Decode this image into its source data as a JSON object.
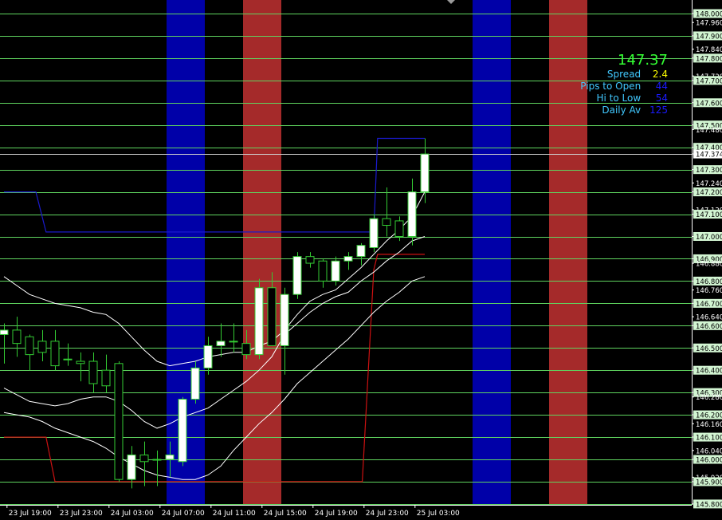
{
  "colors": {
    "background": "#000000",
    "grid": "#5fd45f",
    "bull_body": "#ffffff",
    "bear_body": "#000000",
    "candle_line": "#33cc33",
    "blue_band": "#0000a8",
    "red_band": "#a52a2a",
    "upper_channel": "#1a1acc",
    "lower_channel": "#cc1111",
    "ma_line": "#ffffff",
    "price_label_bg": "#d2f5d2",
    "axis_text": "#ffffff"
  },
  "info": {
    "price": "147.37",
    "price_color": "#33ff33",
    "label_color": "#41c8ff",
    "rows": [
      {
        "label": "Spread",
        "value": "2.4",
        "value_color": "#ffff00"
      },
      {
        "label": "Pips to Open",
        "value": "44",
        "value_color": "#1a1aff"
      },
      {
        "label": "Hi to Low",
        "value": "54",
        "value_color": "#1a1aff"
      },
      {
        "label": "Daily Av",
        "value": "125",
        "value_color": "#1a1aff"
      }
    ]
  },
  "chart_data": {
    "type": "candlestick",
    "symbol_price_scale": "USDJPY-style",
    "ylim": [
      145.78,
      148.02
    ],
    "x_time_labels": [
      "23 Jul 19:00",
      "23 Jul 23:00",
      "24 Jul 03:00",
      "24 Jul 07:00",
      "24 Jul 11:00",
      "24 Jul 15:00",
      "24 Jul 19:00",
      "24 Jul 23:00",
      "25 Jul 03:00"
    ],
    "x_label_bars": [
      0.3,
      4.3,
      8.3,
      12.3,
      16.3,
      20.3,
      24.3,
      28.3,
      32.3
    ],
    "level_lines": [
      148.0,
      147.9,
      147.8,
      147.7,
      147.6,
      147.5,
      147.4,
      147.3,
      147.2,
      147.1,
      147.0,
      146.9,
      146.8,
      146.7,
      146.6,
      146.5,
      146.4,
      146.3,
      146.2,
      146.1,
      146.0,
      145.9,
      145.8
    ],
    "axis_tick_labels": [
      {
        "price": 148.0,
        "text": "148.000",
        "boxed": true
      },
      {
        "price": 147.96,
        "text": "147.960",
        "boxed": false
      },
      {
        "price": 147.9,
        "text": "147.900",
        "boxed": true
      },
      {
        "price": 147.84,
        "text": "147.840",
        "boxed": false
      },
      {
        "price": 147.8,
        "text": "147.800",
        "boxed": true
      },
      {
        "price": 147.72,
        "text": "147.720",
        "boxed": false
      },
      {
        "price": 147.7,
        "text": "147.700",
        "boxed": true
      },
      {
        "price": 147.6,
        "text": "147.600",
        "boxed": true
      },
      {
        "price": 147.5,
        "text": "147.500",
        "boxed": true
      },
      {
        "price": 147.48,
        "text": "147.480",
        "boxed": false
      },
      {
        "price": 147.4,
        "text": "147.400",
        "boxed": true
      },
      {
        "price": 147.37,
        "text": "147.374",
        "boxed": true,
        "current": true
      },
      {
        "price": 147.3,
        "text": "147.300",
        "boxed": true
      },
      {
        "price": 147.24,
        "text": "147.240",
        "boxed": false
      },
      {
        "price": 147.2,
        "text": "147.200",
        "boxed": true
      },
      {
        "price": 147.12,
        "text": "147.120",
        "boxed": false
      },
      {
        "price": 147.1,
        "text": "147.100",
        "boxed": true
      },
      {
        "price": 147.0,
        "text": "147.000",
        "boxed": true
      },
      {
        "price": 146.9,
        "text": "146.900",
        "boxed": true
      },
      {
        "price": 146.88,
        "text": "146.880",
        "boxed": false
      },
      {
        "price": 146.8,
        "text": "146.800",
        "boxed": true
      },
      {
        "price": 146.76,
        "text": "146.760",
        "boxed": false
      },
      {
        "price": 146.7,
        "text": "146.700",
        "boxed": true
      },
      {
        "price": 146.64,
        "text": "146.640",
        "boxed": false
      },
      {
        "price": 146.6,
        "text": "146.600",
        "boxed": true
      },
      {
        "price": 146.5,
        "text": "146.500",
        "boxed": true
      },
      {
        "price": 146.4,
        "text": "146.400",
        "boxed": true
      },
      {
        "price": 146.3,
        "text": "146.300",
        "boxed": true
      },
      {
        "price": 146.28,
        "text": "146.280",
        "boxed": false
      },
      {
        "price": 146.2,
        "text": "146.200",
        "boxed": true
      },
      {
        "price": 146.16,
        "text": "146.160",
        "boxed": false
      },
      {
        "price": 146.1,
        "text": "146.100",
        "boxed": true
      },
      {
        "price": 146.04,
        "text": "146.040",
        "boxed": false
      },
      {
        "price": 146.0,
        "text": "146.000",
        "boxed": true
      },
      {
        "price": 145.92,
        "text": "145.920",
        "boxed": false
      },
      {
        "price": 145.9,
        "text": "145.900",
        "boxed": true
      },
      {
        "price": 145.8,
        "text": "145.800",
        "boxed": true
      }
    ],
    "session_bands": [
      {
        "color": "blue",
        "start_bar": 12.75,
        "end_bar": 15.75
      },
      {
        "color": "red",
        "start_bar": 18.75,
        "end_bar": 21.75
      },
      {
        "color": "blue",
        "start_bar": 36.75,
        "end_bar": 39.75
      },
      {
        "color": "red",
        "start_bar": 42.75,
        "end_bar": 45.75
      }
    ],
    "candles": [
      {
        "o": 146.56,
        "h": 146.61,
        "l": 146.43,
        "c": 146.58
      },
      {
        "o": 146.58,
        "h": 146.64,
        "l": 146.46,
        "c": 146.52
      },
      {
        "o": 146.55,
        "h": 146.56,
        "l": 146.4,
        "c": 146.47
      },
      {
        "o": 146.53,
        "h": 146.58,
        "l": 146.44,
        "c": 146.48
      },
      {
        "o": 146.53,
        "h": 146.58,
        "l": 146.4,
        "c": 146.42
      },
      {
        "o": 146.45,
        "h": 146.52,
        "l": 146.42,
        "c": 146.45
      },
      {
        "o": 146.44,
        "h": 146.48,
        "l": 146.35,
        "c": 146.43
      },
      {
        "o": 146.44,
        "h": 146.48,
        "l": 146.3,
        "c": 146.34
      },
      {
        "o": 146.4,
        "h": 146.47,
        "l": 146.3,
        "c": 146.33
      },
      {
        "o": 146.43,
        "h": 146.44,
        "l": 145.9,
        "c": 145.91
      },
      {
        "o": 145.91,
        "h": 146.06,
        "l": 145.87,
        "c": 146.02
      },
      {
        "o": 146.02,
        "h": 146.08,
        "l": 145.88,
        "c": 145.99
      },
      {
        "o": 146.0,
        "h": 146.04,
        "l": 145.88,
        "c": 146.0
      },
      {
        "o": 146.0,
        "h": 146.08,
        "l": 145.92,
        "c": 146.02
      },
      {
        "o": 145.99,
        "h": 146.28,
        "l": 145.97,
        "c": 146.27
      },
      {
        "o": 146.27,
        "h": 146.44,
        "l": 146.25,
        "c": 146.41
      },
      {
        "o": 146.41,
        "h": 146.55,
        "l": 146.38,
        "c": 146.51
      },
      {
        "o": 146.51,
        "h": 146.61,
        "l": 146.46,
        "c": 146.53
      },
      {
        "o": 146.53,
        "h": 146.61,
        "l": 146.48,
        "c": 146.53
      },
      {
        "o": 146.52,
        "h": 146.58,
        "l": 146.45,
        "c": 146.47
      },
      {
        "o": 146.47,
        "h": 146.81,
        "l": 146.45,
        "c": 146.77
      },
      {
        "o": 146.77,
        "h": 146.84,
        "l": 146.51,
        "c": 146.51
      },
      {
        "o": 146.51,
        "h": 146.77,
        "l": 146.38,
        "c": 146.74
      },
      {
        "o": 146.74,
        "h": 146.93,
        "l": 146.72,
        "c": 146.91
      },
      {
        "o": 146.91,
        "h": 146.93,
        "l": 146.86,
        "c": 146.88
      },
      {
        "o": 146.89,
        "h": 146.9,
        "l": 146.77,
        "c": 146.8
      },
      {
        "o": 146.8,
        "h": 146.91,
        "l": 146.78,
        "c": 146.89
      },
      {
        "o": 146.89,
        "h": 146.93,
        "l": 146.85,
        "c": 146.91
      },
      {
        "o": 146.91,
        "h": 146.97,
        "l": 146.87,
        "c": 146.96
      },
      {
        "o": 146.95,
        "h": 147.1,
        "l": 146.93,
        "c": 147.08
      },
      {
        "o": 147.08,
        "h": 147.22,
        "l": 147.0,
        "c": 147.05
      },
      {
        "o": 147.07,
        "h": 147.09,
        "l": 146.98,
        "c": 147.0
      },
      {
        "o": 147.0,
        "h": 147.26,
        "l": 146.96,
        "c": 147.2
      },
      {
        "o": 147.2,
        "h": 147.44,
        "l": 147.15,
        "c": 147.37
      }
    ],
    "upper_channel": [
      [
        0,
        147.2
      ],
      [
        2.5,
        147.2
      ],
      [
        3.3,
        147.02
      ],
      [
        29,
        147.02
      ],
      [
        29.3,
        147.44
      ],
      [
        33,
        147.44
      ]
    ],
    "lower_channel": [
      [
        0,
        146.1
      ],
      [
        3.3,
        146.1
      ],
      [
        4,
        145.9
      ],
      [
        28.1,
        145.9
      ],
      [
        29,
        146.85
      ],
      [
        29.3,
        146.92
      ],
      [
        33,
        146.92
      ]
    ],
    "ma_upper": [
      [
        0,
        146.82
      ],
      [
        1,
        146.78
      ],
      [
        2,
        146.74
      ],
      [
        3,
        146.72
      ],
      [
        4,
        146.7
      ],
      [
        5,
        146.69
      ],
      [
        6,
        146.68
      ],
      [
        7,
        146.66
      ],
      [
        8,
        146.65
      ],
      [
        9,
        146.61
      ],
      [
        10,
        146.55
      ],
      [
        11,
        146.49
      ],
      [
        12,
        146.44
      ],
      [
        13,
        146.42
      ],
      [
        14,
        146.43
      ],
      [
        15,
        146.44
      ],
      [
        16,
        146.46
      ],
      [
        17,
        146.47
      ],
      [
        18,
        146.48
      ],
      [
        19,
        146.48
      ],
      [
        20,
        146.51
      ],
      [
        21,
        146.53
      ],
      [
        22,
        146.58
      ],
      [
        23,
        146.65
      ],
      [
        24,
        146.71
      ],
      [
        25,
        146.74
      ],
      [
        26,
        146.76
      ],
      [
        27,
        146.81
      ],
      [
        28,
        146.86
      ],
      [
        29,
        146.92
      ],
      [
        30,
        146.98
      ],
      [
        31,
        147.03
      ],
      [
        32,
        147.09
      ],
      [
        33,
        147.2
      ]
    ],
    "ma_mid": [
      [
        0,
        146.32
      ],
      [
        1,
        146.29
      ],
      [
        2,
        146.26
      ],
      [
        3,
        146.25
      ],
      [
        4,
        146.24
      ],
      [
        5,
        146.25
      ],
      [
        6,
        146.27
      ],
      [
        7,
        146.28
      ],
      [
        8,
        146.28
      ],
      [
        9,
        146.26
      ],
      [
        10,
        146.22
      ],
      [
        11,
        146.17
      ],
      [
        12,
        146.14
      ],
      [
        13,
        146.16
      ],
      [
        14,
        146.19
      ],
      [
        15,
        146.21
      ],
      [
        16,
        146.23
      ],
      [
        17,
        146.27
      ],
      [
        18,
        146.31
      ],
      [
        19,
        146.35
      ],
      [
        20,
        146.4
      ],
      [
        21,
        146.46
      ],
      [
        22,
        146.56
      ],
      [
        23,
        146.61
      ],
      [
        24,
        146.66
      ],
      [
        25,
        146.7
      ],
      [
        26,
        146.73
      ],
      [
        27,
        146.75
      ],
      [
        28,
        146.8
      ],
      [
        29,
        146.84
      ],
      [
        30,
        146.89
      ],
      [
        31,
        146.93
      ],
      [
        32,
        146.98
      ],
      [
        33,
        147.0
      ]
    ],
    "ma_lower": [
      [
        0,
        146.21
      ],
      [
        1,
        146.2
      ],
      [
        2,
        146.19
      ],
      [
        3,
        146.17
      ],
      [
        4,
        146.14
      ],
      [
        5,
        146.12
      ],
      [
        6,
        146.1
      ],
      [
        7,
        146.08
      ],
      [
        8,
        146.05
      ],
      [
        9,
        146.01
      ],
      [
        10,
        145.98
      ],
      [
        11,
        145.95
      ],
      [
        12,
        145.93
      ],
      [
        13,
        145.92
      ],
      [
        14,
        145.91
      ],
      [
        15,
        145.91
      ],
      [
        16,
        145.93
      ],
      [
        17,
        145.97
      ],
      [
        18,
        146.04
      ],
      [
        19,
        146.1
      ],
      [
        20,
        146.16
      ],
      [
        21,
        146.21
      ],
      [
        22,
        146.27
      ],
      [
        23,
        146.34
      ],
      [
        24,
        146.39
      ],
      [
        25,
        146.44
      ],
      [
        26,
        146.49
      ],
      [
        27,
        146.54
      ],
      [
        28,
        146.6
      ],
      [
        29,
        146.66
      ],
      [
        30,
        146.71
      ],
      [
        31,
        146.75
      ],
      [
        32,
        146.8
      ],
      [
        33,
        146.82
      ]
    ]
  }
}
